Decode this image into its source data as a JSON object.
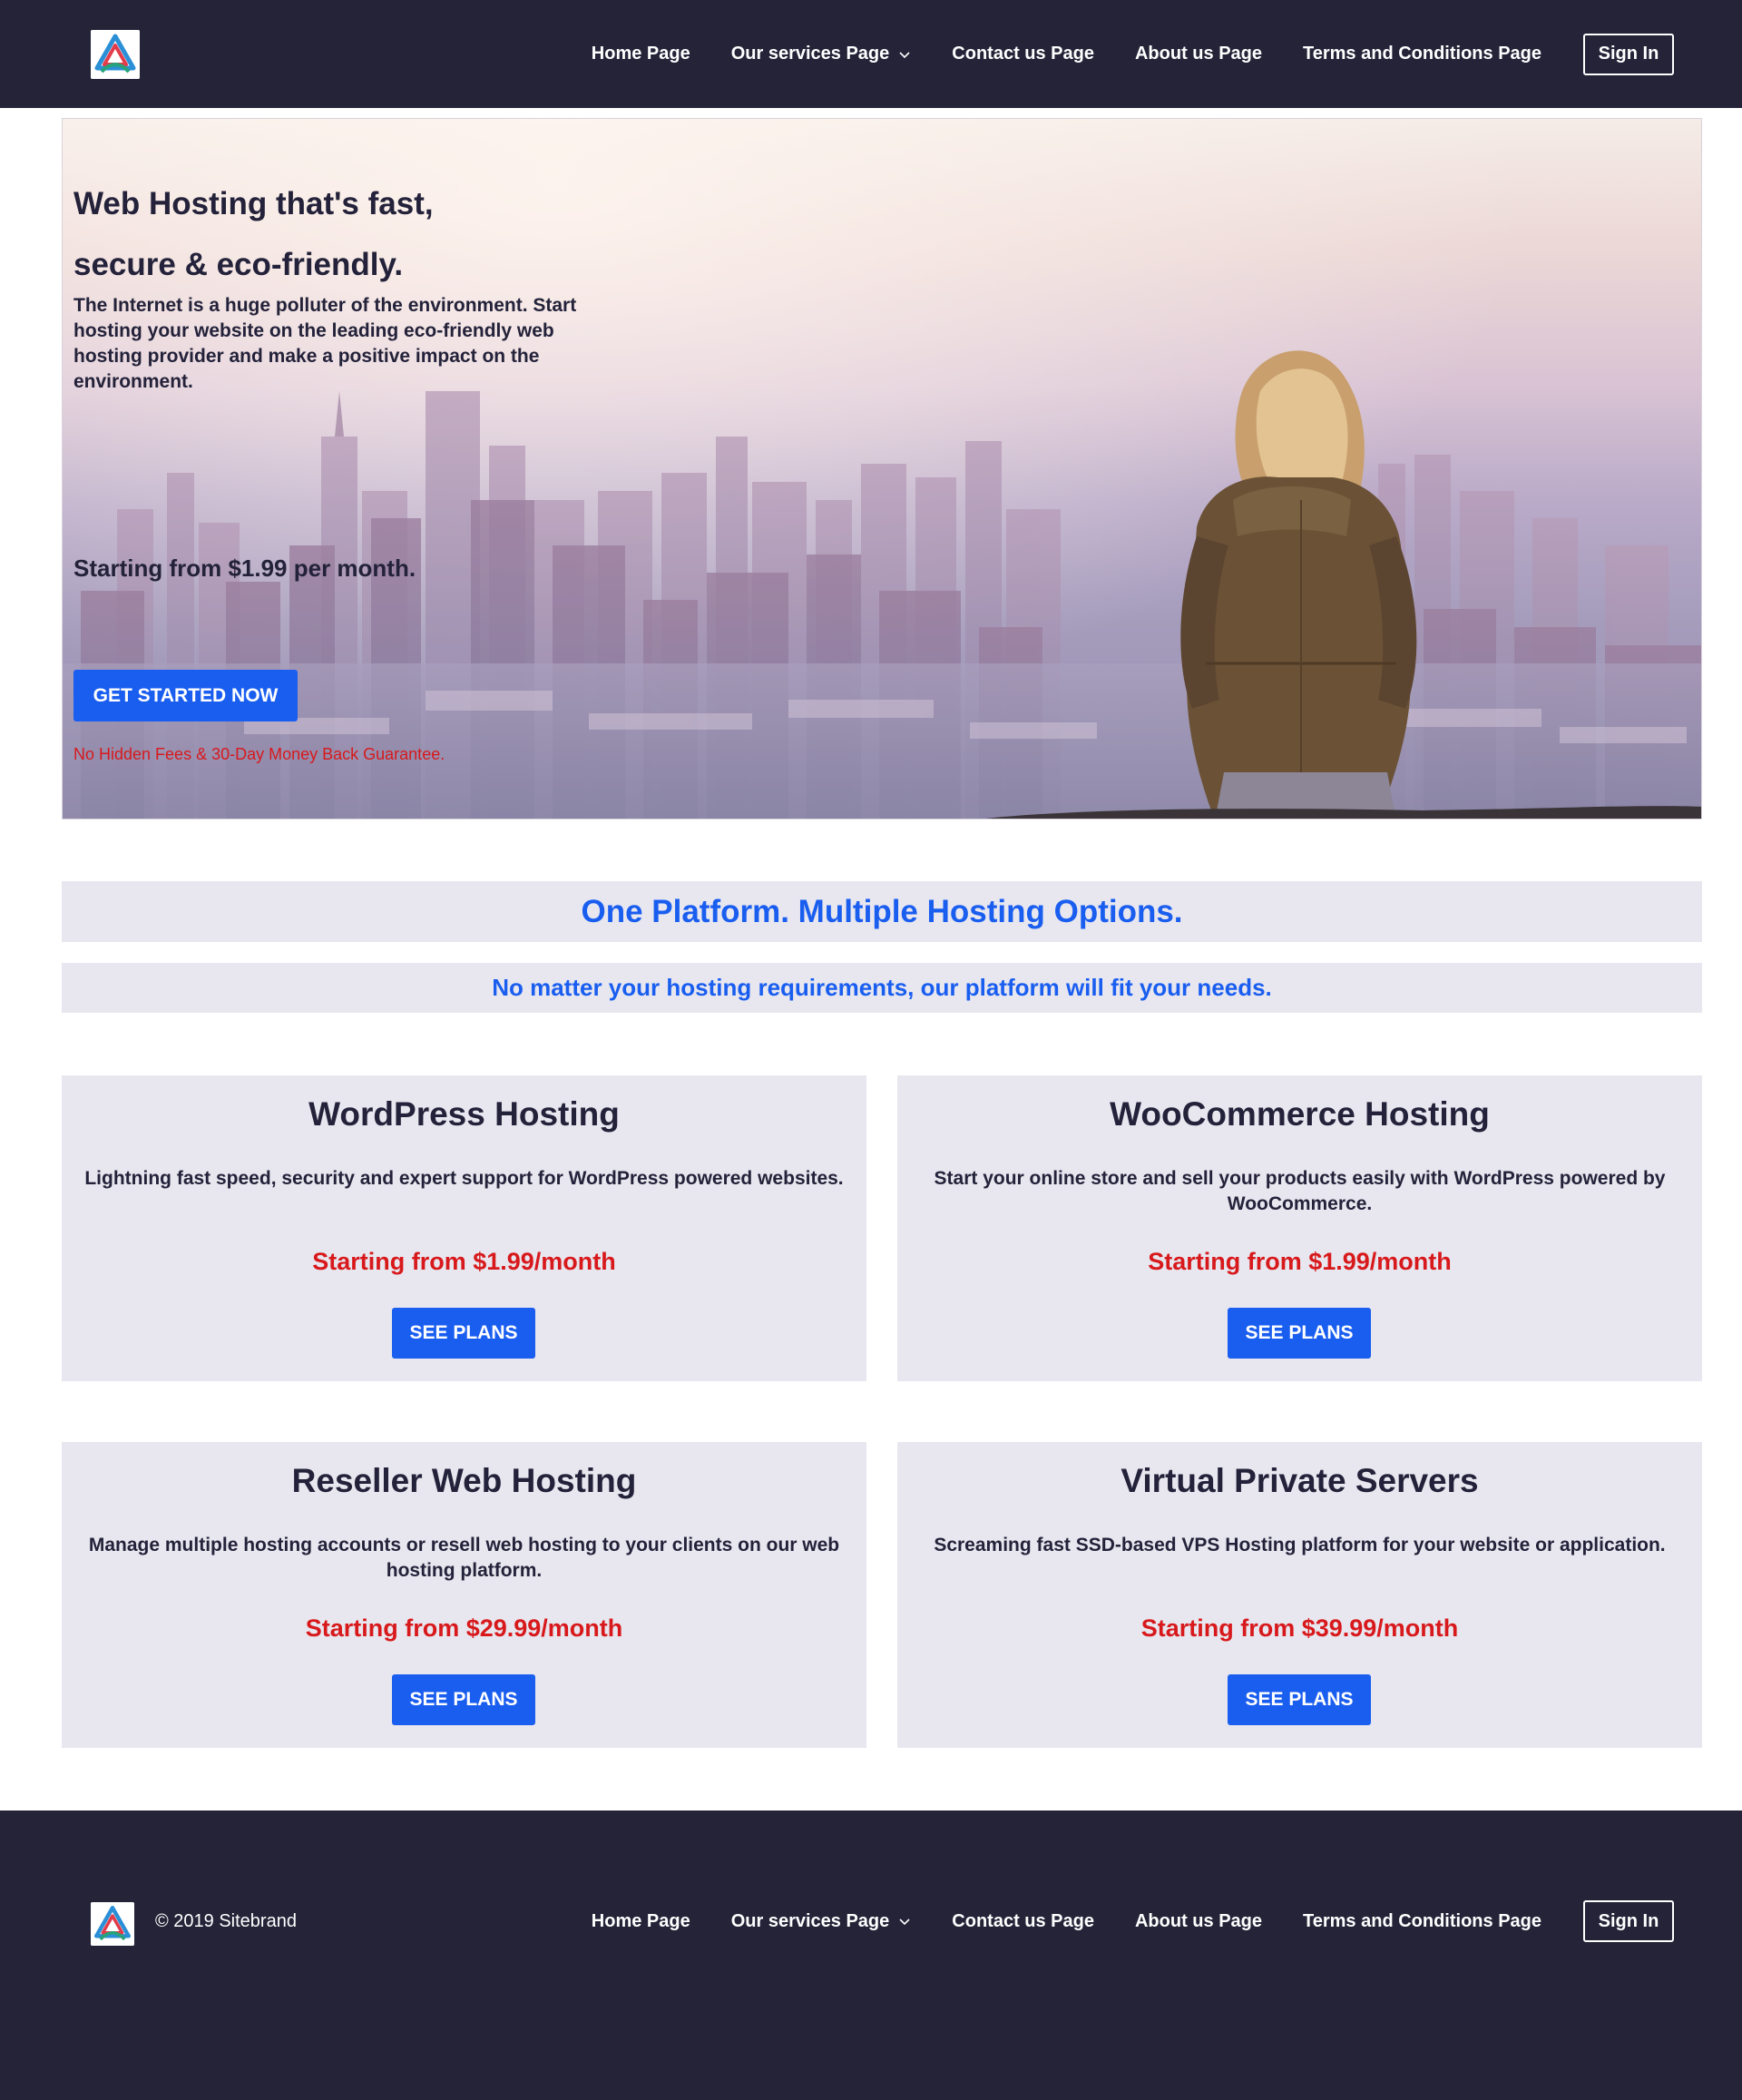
{
  "header": {
    "logo_icon": "sitebrand-triangle-logo",
    "nav": [
      {
        "label": "Home Page"
      },
      {
        "label": "Our services Page",
        "icon": "chevron-down-icon"
      },
      {
        "label": "Contact us Page"
      },
      {
        "label": "About us Page"
      },
      {
        "label": "Terms and Conditions Page"
      }
    ],
    "signin_label": "Sign In"
  },
  "hero": {
    "title_line1": "Web Hosting that's fast,",
    "title_line2": "secure & eco-friendly.",
    "text": "The Internet is a huge polluter of the environment. Start hosting your website on the leading eco-friendly web hosting provider and make a positive impact on the environment.",
    "price": "Starting from $1.99 per month.",
    "cta_label": "GET STARTED NOW",
    "note": "No Hidden Fees & 30-Day Money Back Guarantee."
  },
  "section": {
    "heading": "One Platform. Multiple Hosting Options.",
    "subheading": "No matter your hosting requirements, our platform will fit your needs."
  },
  "cards": [
    {
      "title": "WordPress Hosting",
      "desc": "Lightning fast speed, security and expert support for WordPress powered websites.",
      "price": "Starting from $1.99/month",
      "button": "SEE PLANS"
    },
    {
      "title": "WooCommerce Hosting",
      "desc": "Start your online store and sell your products easily with WordPress powered by WooCommerce.",
      "price": "Starting from $1.99/month",
      "button": "SEE PLANS"
    },
    {
      "title": "Reseller Web Hosting",
      "desc": "Manage multiple hosting accounts or resell web hosting to your clients on our web hosting platform.",
      "price": "Starting from $29.99/month",
      "button": "SEE PLANS"
    },
    {
      "title": "Virtual Private Servers",
      "desc": "Screaming fast SSD-based VPS Hosting platform for your website or application.",
      "price": "Starting from $39.99/month",
      "button": "SEE PLANS"
    }
  ],
  "footer": {
    "copyright": "© 2019 Sitebrand",
    "nav": [
      {
        "label": "Home Page"
      },
      {
        "label": "Our services Page",
        "icon": "chevron-down-icon"
      },
      {
        "label": "Contact us Page"
      },
      {
        "label": "About us Page"
      },
      {
        "label": "Terms and Conditions Page"
      }
    ],
    "signin_label": "Sign In"
  },
  "colors": {
    "nav_background": "#242338",
    "accent_blue": "#1a5ef0",
    "price_red": "#d8191c",
    "card_background": "#e8e7ef"
  }
}
